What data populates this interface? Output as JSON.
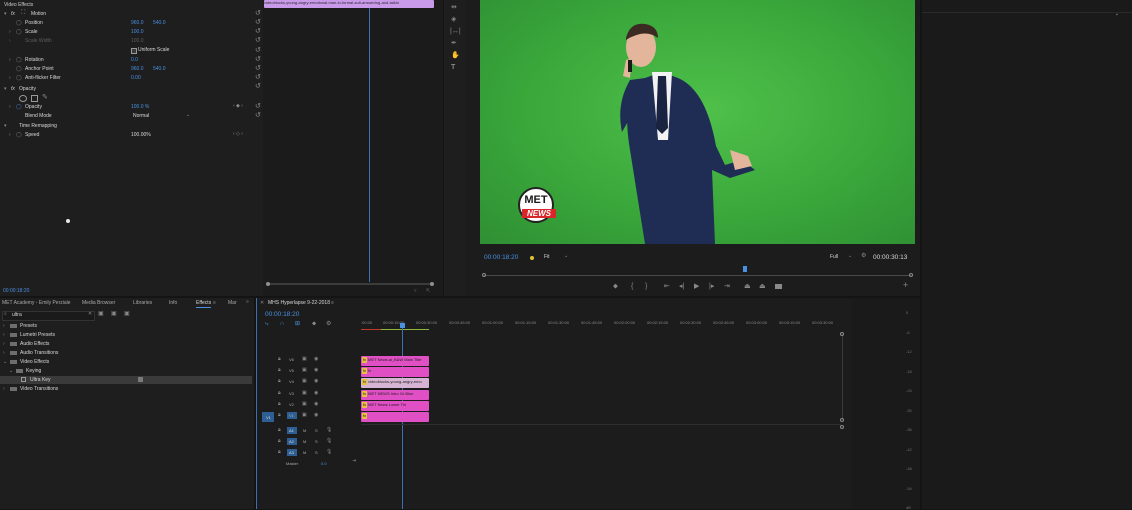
{
  "effect_controls": {
    "header": "Video Effects",
    "motion": "Motion",
    "position": {
      "label": "Position",
      "x": "960.0",
      "y": "540.0"
    },
    "scale": {
      "label": "Scale",
      "value": "100.0"
    },
    "scale_width": {
      "label": "Scale Width",
      "value": "100.0"
    },
    "uniform_scale": "Uniform Scale",
    "rotation": {
      "label": "Rotation",
      "value": "0.0"
    },
    "anchor_point": {
      "label": "Anchor Point",
      "x": "960.0",
      "y": "540.0"
    },
    "anti_flicker": {
      "label": "Anti-flicker Filter",
      "value": "0.00"
    },
    "opacity_group": "Opacity",
    "opacity": {
      "label": "Opacity",
      "value": "100.0 %"
    },
    "blend_mode": {
      "label": "Blend Mode",
      "value": "Normal"
    },
    "time_remapping": "Time Remapping",
    "speed": {
      "label": "Speed",
      "value": "100.00%"
    },
    "timecode": "00:00:18:20"
  },
  "ec_timeline": {
    "clip_name": "videoblocks-young-angry-emotional-man-in-formal-suit-answering-and-talkin"
  },
  "program_monitor": {
    "timecode": "00:00:18:20",
    "fit": "Fit",
    "quality": "Full",
    "duration": "00:00:30:13",
    "logo_top": "MET",
    "logo_bottom": "NEWS"
  },
  "project_panel": {
    "tabs": [
      "MET Academy - Emily Perziale",
      "Media Browser",
      "Libraries",
      "Info",
      "Effects",
      "Mar"
    ],
    "active_tab": "Effects",
    "search_value": "ultra",
    "tree": [
      "Presets",
      "Lumetri Presets",
      "Audio Effects",
      "Audio Transitions",
      "Video Effects",
      "Keying",
      "Ultra Key",
      "Video Transitions"
    ]
  },
  "timeline": {
    "sequence_name": "MHS Hyperlapse 9-22-2018",
    "timecode": "00:00:18:20",
    "ruler": [
      ":00:00",
      "00:00:15:00",
      "00:00:30:00",
      "00:00:45:00",
      "00:01:00:00",
      "00:01:15:00",
      "00:01:30:00",
      "00:01:45:00",
      "00:02:00:00",
      "00:02:15:00",
      "00:02:30:00",
      "00:02:45:00",
      "00:03:00:00",
      "00:03:15:00",
      "00:03:30:00"
    ],
    "video_tracks": [
      "V6",
      "V5",
      "V4",
      "V3",
      "V2",
      "V1"
    ],
    "video_source": "V1",
    "audio_tracks": [
      "A1",
      "A2",
      "A3"
    ],
    "audio_source": "A1",
    "master": {
      "label": "Master",
      "value": "0.0"
    },
    "clips": [
      {
        "track": "V6",
        "label": "MET News.ai_B&W Main Title",
        "color": "#e04fc4"
      },
      {
        "track": "V5",
        "label": "fx",
        "color": "#e04fc4"
      },
      {
        "track": "V4",
        "label": "videoblocks-young-angry-emo",
        "color": "#d7b4d4"
      },
      {
        "track": "V3",
        "label": "MET NEWS Intro Gr Blue",
        "color": "#e04fc4"
      },
      {
        "track": "V2",
        "label": "MET News Lower Thi",
        "color": "#e04fc4"
      },
      {
        "track": "V1",
        "label": "",
        "color": "#e04fc4"
      }
    ]
  },
  "audio_meter": {
    "scale": [
      "0",
      "-6",
      "-12",
      "-18",
      "-24",
      "-30",
      "-36",
      "-42",
      "-48",
      "-54",
      "dB"
    ]
  },
  "colors": {
    "accent_blue": "#4a90e2",
    "green_screen": "#39a83b",
    "clip_pink": "#e04fc4",
    "clip_light": "#d7b4d4",
    "work_area": "#8ab63a"
  }
}
